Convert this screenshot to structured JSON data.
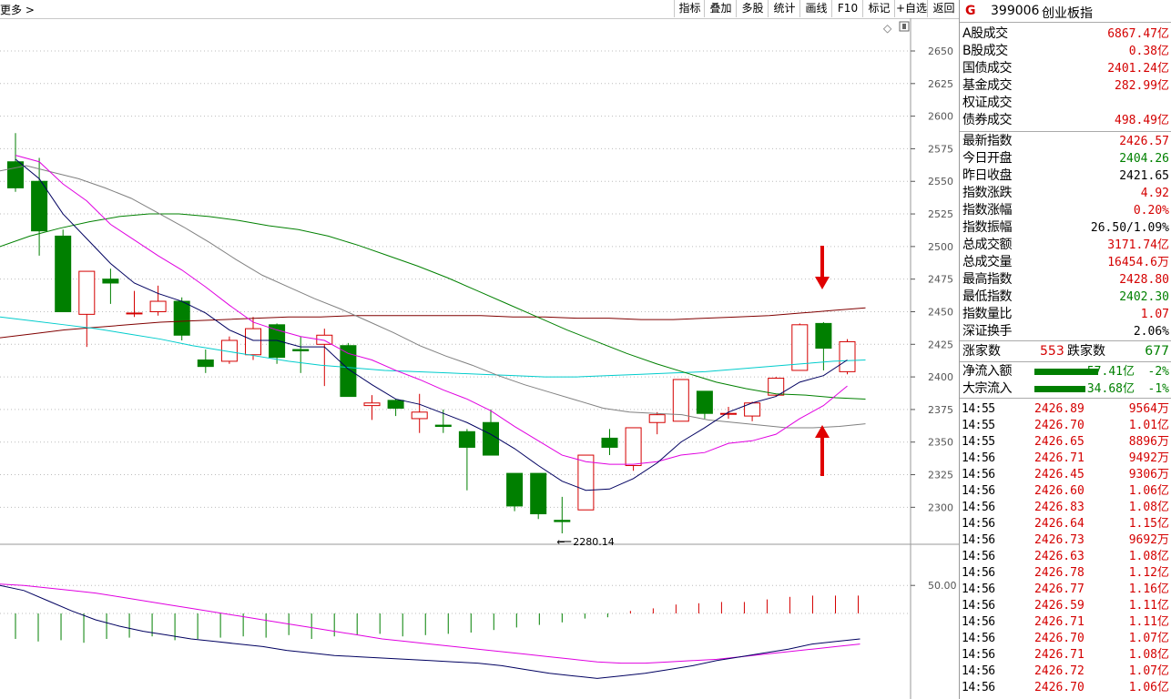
{
  "toolbar": {
    "more_label": "更多 >",
    "buttons": [
      "指标",
      "叠加",
      "多股",
      "统计",
      "画线",
      "F10",
      "标记",
      "+自选",
      "返回"
    ]
  },
  "chart_data": {
    "type": "candlestick",
    "y_ticks": [
      2650,
      2625,
      2600,
      2575,
      2550,
      2525,
      2500,
      2475,
      2450,
      2425,
      2400,
      2375,
      2350,
      2325,
      2300
    ],
    "ylim": [
      2270,
      2672
    ],
    "low_annotation": "2280.14",
    "sub_y_label": "50.00",
    "colors": {
      "up": "#d40000",
      "down": "#007f00",
      "ma5": "#000060",
      "ma10": "#e000e0",
      "ma20": "#808080",
      "ma60": "#008000",
      "ma120": "#00cccc",
      "ma250": "#800000",
      "grid": "#bcbcbc"
    },
    "candles": [
      {
        "o": 2565,
        "c": 2545,
        "h": 2587,
        "l": 2542
      },
      {
        "o": 2550,
        "c": 2512,
        "h": 2568,
        "l": 2493
      },
      {
        "o": 2508,
        "c": 2450,
        "h": 2513,
        "l": 2450
      },
      {
        "o": 2448,
        "c": 2481,
        "h": 2481,
        "l": 2423
      },
      {
        "o": 2475,
        "c": 2472,
        "h": 2483,
        "l": 2456
      },
      {
        "o": 2449,
        "c": 2449,
        "h": 2466,
        "l": 2446
      },
      {
        "o": 2450,
        "c": 2458,
        "h": 2470,
        "l": 2447
      },
      {
        "o": 2458,
        "c": 2432,
        "h": 2461,
        "l": 2428
      },
      {
        "o": 2413,
        "c": 2408,
        "h": 2421,
        "l": 2403
      },
      {
        "o": 2412,
        "c": 2428,
        "h": 2431,
        "l": 2410
      },
      {
        "o": 2417,
        "c": 2437,
        "h": 2446,
        "l": 2413
      },
      {
        "o": 2440,
        "c": 2415,
        "h": 2441,
        "l": 2410
      },
      {
        "o": 2421,
        "c": 2420,
        "h": 2431,
        "l": 2403
      },
      {
        "o": 2425,
        "c": 2432,
        "h": 2437,
        "l": 2393
      },
      {
        "o": 2424,
        "c": 2385,
        "h": 2426,
        "l": 2385
      },
      {
        "o": 2378,
        "c": 2380,
        "h": 2386,
        "l": 2367
      },
      {
        "o": 2382,
        "c": 2376,
        "h": 2383,
        "l": 2370
      },
      {
        "o": 2368,
        "c": 2373,
        "h": 2387,
        "l": 2357
      },
      {
        "o": 2363,
        "c": 2362,
        "h": 2375,
        "l": 2357
      },
      {
        "o": 2358,
        "c": 2346,
        "h": 2360,
        "l": 2313
      },
      {
        "o": 2365,
        "c": 2340,
        "h": 2375,
        "l": 2340
      },
      {
        "o": 2326,
        "c": 2301,
        "h": 2326,
        "l": 2297
      },
      {
        "o": 2326,
        "c": 2295,
        "h": 2326,
        "l": 2291
      },
      {
        "o": 2290,
        "c": 2289,
        "h": 2308,
        "l": 2280
      },
      {
        "o": 2298,
        "c": 2340,
        "h": 2340,
        "l": 2298
      },
      {
        "o": 2353,
        "c": 2346,
        "h": 2360,
        "l": 2340
      },
      {
        "o": 2332,
        "c": 2361,
        "h": 2361,
        "l": 2328
      },
      {
        "o": 2365,
        "c": 2371,
        "h": 2373,
        "l": 2356
      },
      {
        "o": 2366,
        "c": 2398,
        "h": 2398,
        "l": 2366
      },
      {
        "o": 2389,
        "c": 2372,
        "h": 2389,
        "l": 2368
      },
      {
        "o": 2372,
        "c": 2372,
        "h": 2377,
        "l": 2368
      },
      {
        "o": 2370,
        "c": 2380,
        "h": 2381,
        "l": 2366
      },
      {
        "o": 2386,
        "c": 2399,
        "h": 2400,
        "l": 2385
      },
      {
        "o": 2405,
        "c": 2440,
        "h": 2441,
        "l": 2405
      },
      {
        "o": 2441,
        "c": 2422,
        "h": 2442,
        "l": 2405
      },
      {
        "o": 2404,
        "c": 2427,
        "h": 2429,
        "l": 2402
      }
    ],
    "ma5": [
      2567,
      2552,
      2525,
      2506,
      2487,
      2472,
      2464,
      2458,
      2449,
      2436,
      2428,
      2428,
      2423,
      2423,
      2406,
      2394,
      2383,
      2379,
      2372,
      2365,
      2356,
      2345,
      2332,
      2320,
      2313,
      2314,
      2322,
      2334,
      2350,
      2361,
      2373,
      2380,
      2385,
      2396,
      2401,
      2413
    ],
    "ma10": [
      2570,
      2565,
      2548,
      2535,
      2517,
      2505,
      2493,
      2482,
      2469,
      2455,
      2442,
      2436,
      2431,
      2428,
      2418,
      2413,
      2405,
      2398,
      2390,
      2383,
      2374,
      2362,
      2351,
      2340,
      2335,
      2333,
      2333,
      2335,
      2340,
      2342,
      2349,
      2351,
      2356,
      2368,
      2378,
      2393
    ],
    "ma20": [
      2558,
      2562,
      2557,
      2552,
      2545,
      2537,
      2526,
      2515,
      2503,
      2490,
      2478,
      2469,
      2460,
      2452,
      2443,
      2434,
      2424,
      2416,
      2409,
      2401,
      2394,
      2388,
      2382,
      2376,
      2373,
      2372,
      2371,
      2367,
      2365,
      2363,
      2361,
      2361,
      2362,
      2364
    ],
    "ma60": [
      2500,
      2508,
      2514,
      2519,
      2523,
      2525,
      2525,
      2523,
      2520,
      2516,
      2513,
      2508,
      2501,
      2493,
      2485,
      2476,
      2466,
      2456,
      2446,
      2436,
      2427,
      2418,
      2410,
      2403,
      2396,
      2391,
      2387,
      2386,
      2384,
      2383
    ],
    "ma120": [
      2446,
      2443,
      2440,
      2437,
      2433,
      2429,
      2424,
      2420,
      2416,
      2412,
      2409,
      2407,
      2405,
      2404,
      2403,
      2402,
      2401,
      2400,
      2400,
      2401,
      2402,
      2403,
      2404,
      2406,
      2408,
      2410,
      2412,
      2413
    ],
    "ma250": [
      2430,
      2433,
      2436,
      2438,
      2440,
      2442,
      2443,
      2444,
      2445,
      2446,
      2446,
      2447,
      2447,
      2447,
      2447,
      2447,
      2446,
      2446,
      2445,
      2445,
      2444,
      2444,
      2445,
      2446,
      2447,
      2449,
      2451,
      2453
    ],
    "macd_hist": [
      -20,
      -22,
      -21,
      -23,
      -20,
      -19,
      -18,
      -21,
      -20,
      -19,
      -18,
      -19,
      -17,
      -20,
      -18,
      -17,
      -16,
      -18,
      -17,
      -16,
      -15,
      -13,
      -11,
      -9,
      -7,
      -4,
      -3,
      2,
      4,
      7,
      8,
      9,
      9,
      11,
      13,
      14,
      14,
      14
    ],
    "dif": [
      22,
      18,
      10,
      2,
      -5,
      -10,
      -14,
      -17,
      -20,
      -22,
      -24,
      -26,
      -29,
      -31,
      -33,
      -34,
      -35,
      -36,
      -37,
      -38,
      -39,
      -41,
      -44,
      -47,
      -49,
      -51,
      -49,
      -47,
      -44,
      -41,
      -37,
      -34,
      -31,
      -28,
      -24,
      -22,
      -20
    ],
    "dea": [
      23,
      22,
      20,
      18,
      16,
      13,
      10,
      7,
      4,
      1,
      -2,
      -5,
      -8,
      -11,
      -14,
      -17,
      -20,
      -22,
      -24,
      -26,
      -28,
      -30,
      -32,
      -34,
      -36,
      -38,
      -39,
      -39,
      -38,
      -37,
      -36,
      -34,
      -32,
      -30,
      -28,
      -26,
      -24
    ]
  },
  "panel": {
    "logo": "G",
    "code": "399006",
    "name": "创业板指",
    "volumes": [
      {
        "label": "A股成交",
        "value": "6867.47亿",
        "color": "red"
      },
      {
        "label": "B股成交",
        "value": "0.38亿",
        "color": "red"
      },
      {
        "label": "国债成交",
        "value": "2401.24亿",
        "color": "red"
      },
      {
        "label": "基金成交",
        "value": "282.99亿",
        "color": "red"
      },
      {
        "label": "权证成交",
        "value": "",
        "color": "red"
      },
      {
        "label": "债券成交",
        "value": "498.49亿",
        "color": "red"
      }
    ],
    "stats": [
      {
        "label": "最新指数",
        "value": "2426.57",
        "color": "red"
      },
      {
        "label": "今日开盘",
        "value": "2404.26",
        "color": "green"
      },
      {
        "label": "昨日收盘",
        "value": "2421.65",
        "color": "black"
      },
      {
        "label": "指数涨跌",
        "value": "4.92",
        "color": "red"
      },
      {
        "label": "指数涨幅",
        "value": "0.20%",
        "color": "red"
      },
      {
        "label": "指数振幅",
        "value": "26.50/1.09%",
        "color": "black"
      },
      {
        "label": "总成交额",
        "value": "3171.74亿",
        "color": "red"
      },
      {
        "label": "总成交量",
        "value": "16454.6万",
        "color": "red"
      },
      {
        "label": "最高指数",
        "value": "2428.80",
        "color": "red"
      },
      {
        "label": "最低指数",
        "value": "2402.30",
        "color": "green"
      },
      {
        "label": "指数量比",
        "value": "1.07",
        "color": "red"
      },
      {
        "label": "深证换手",
        "value": "2.06%",
        "color": "black"
      }
    ],
    "updown": {
      "up_label": "涨家数",
      "up": "553",
      "down_label": "跌家数",
      "down": "677"
    },
    "flows": [
      {
        "label": "净流入额",
        "value": "-57.41亿",
        "pct": "-2%"
      },
      {
        "label": "大宗流入",
        "value": "-34.68亿",
        "pct": "-1%"
      }
    ],
    "ticks": [
      {
        "t": "14:55",
        "p": "2426.89",
        "v": "9564万"
      },
      {
        "t": "14:55",
        "p": "2426.70",
        "v": "1.01亿"
      },
      {
        "t": "14:55",
        "p": "2426.65",
        "v": "8896万"
      },
      {
        "t": "14:56",
        "p": "2426.71",
        "v": "9492万"
      },
      {
        "t": "14:56",
        "p": "2426.45",
        "v": "9306万"
      },
      {
        "t": "14:56",
        "p": "2426.60",
        "v": "1.06亿"
      },
      {
        "t": "14:56",
        "p": "2426.83",
        "v": "1.08亿"
      },
      {
        "t": "14:56",
        "p": "2426.64",
        "v": "1.15亿"
      },
      {
        "t": "14:56",
        "p": "2426.73",
        "v": "9692万"
      },
      {
        "t": "14:56",
        "p": "2426.63",
        "v": "1.08亿"
      },
      {
        "t": "14:56",
        "p": "2426.78",
        "v": "1.12亿"
      },
      {
        "t": "14:56",
        "p": "2426.77",
        "v": "1.16亿"
      },
      {
        "t": "14:56",
        "p": "2426.59",
        "v": "1.11亿"
      },
      {
        "t": "14:56",
        "p": "2426.71",
        "v": "1.11亿"
      },
      {
        "t": "14:56",
        "p": "2426.70",
        "v": "1.07亿"
      },
      {
        "t": "14:56",
        "p": "2426.71",
        "v": "1.08亿"
      },
      {
        "t": "14:56",
        "p": "2426.72",
        "v": "1.07亿"
      },
      {
        "t": "14:56",
        "p": "2426.70",
        "v": "1.06亿"
      }
    ]
  }
}
